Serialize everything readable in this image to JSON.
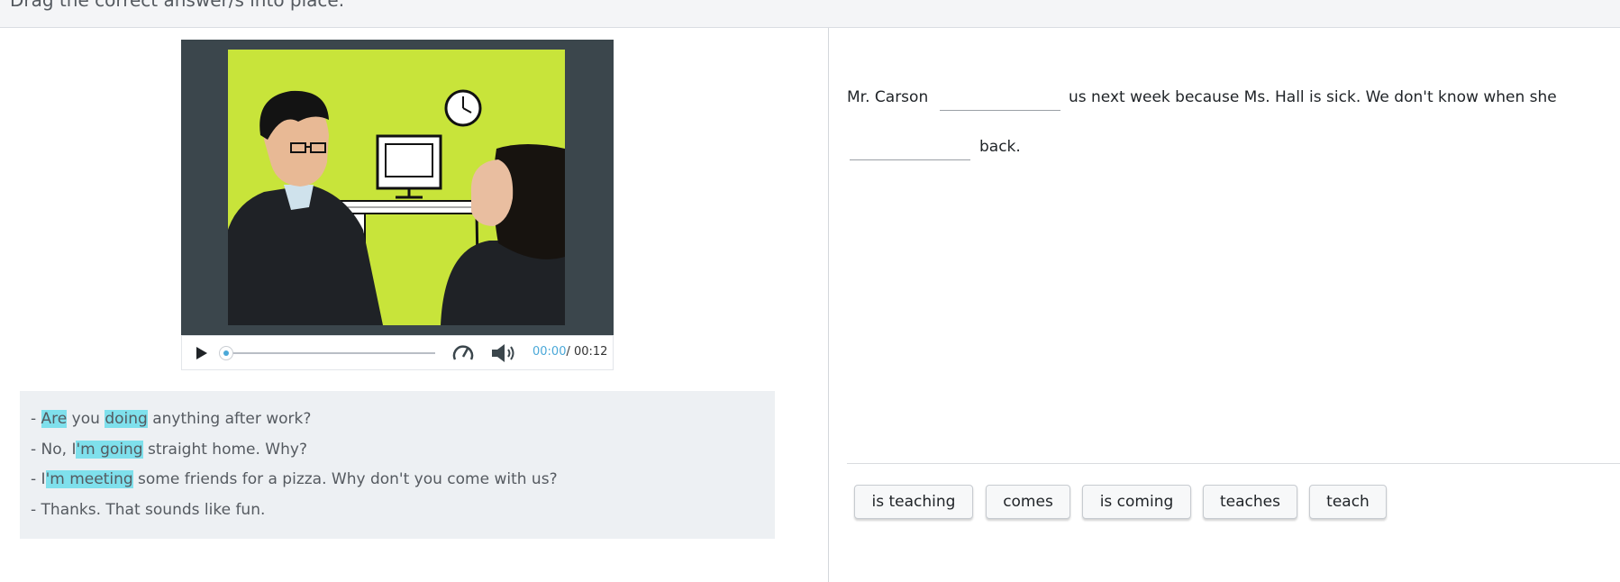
{
  "header": {
    "instruction": "Drag the correct answer/s into place."
  },
  "video": {
    "current_time": "00:00",
    "duration": "/ 00:12",
    "progress": 0,
    "icons": [
      "play-icon",
      "playback-speed-icon",
      "volume-icon"
    ]
  },
  "transcript": {
    "lines": [
      {
        "prefix": "- ",
        "parts": [
          "Are",
          " you ",
          "doing",
          " anything after work?"
        ]
      },
      {
        "prefix": "- No, I",
        "parts": [
          "'m going",
          " straight home. Why?"
        ]
      },
      {
        "prefix": "- I",
        "parts": [
          "'m meeting",
          " some friends for a pizza. Why don't you come with us?"
        ]
      },
      {
        "prefix": "- Thanks. That sounds like fun."
      }
    ]
  },
  "exercise": {
    "segment1": "Mr. Carson",
    "segment2": "us next week because Ms. Hall is sick. We don't know when she",
    "segment3": "back."
  },
  "answer_bank": [
    "is teaching",
    "comes",
    "is coming",
    "teaches",
    "teach"
  ],
  "colors": {
    "highlight": "#7fe0ec",
    "accent": "#4aa8d8",
    "video_bg": "#c8e43a",
    "player_frame": "#3b464c"
  }
}
